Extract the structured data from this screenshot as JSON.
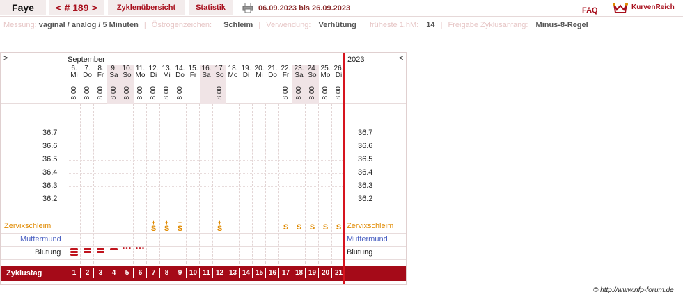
{
  "header": {
    "name": "Faye",
    "cycle_number": "< # 189 >",
    "tab_cycle_overview": "Zyklenübersicht",
    "tab_statistics": "Statistik",
    "date_range": "06.09.2023 bis 26.09.2023",
    "faq": "FAQ",
    "brand": "KurvenReich"
  },
  "meta": {
    "measurement_label": "Messung:",
    "measurement_value": "vaginal / analog / 5 Minuten",
    "estrogen_label": "Östrogenzeichen:",
    "estrogen_value": "Schleim",
    "usage_label": "Verwendung:",
    "usage_value": "Verhütung",
    "earliest_label": "früheste 1.hM:",
    "earliest_value": "14",
    "release_label": "Freigabe Zyklusanfang:",
    "release_value": "Minus-8-Regel"
  },
  "chart": {
    "nav_left": ">",
    "nav_right": "<",
    "month": "September",
    "year": "2023",
    "days": [
      {
        "d": "6.",
        "w": "Mi",
        "t": "8:00",
        "we": false
      },
      {
        "d": "7.",
        "w": "Do",
        "t": "8:00",
        "we": false
      },
      {
        "d": "8.",
        "w": "Fr",
        "t": "8:00",
        "we": false
      },
      {
        "d": "9.",
        "w": "Sa",
        "t": "8:00",
        "we": true
      },
      {
        "d": "10.",
        "w": "So",
        "t": "8:00",
        "we": true
      },
      {
        "d": "11.",
        "w": "Mo",
        "t": "8:00",
        "we": false
      },
      {
        "d": "12.",
        "w": "Di",
        "t": "8:00",
        "we": false
      },
      {
        "d": "13.",
        "w": "Mi",
        "t": "8:00",
        "we": false
      },
      {
        "d": "14.",
        "w": "Do",
        "t": "8:00",
        "we": false
      },
      {
        "d": "15.",
        "w": "Fr",
        "t": "",
        "we": false
      },
      {
        "d": "16.",
        "w": "Sa",
        "t": "",
        "we": true
      },
      {
        "d": "17.",
        "w": "So",
        "t": "8:00",
        "we": true
      },
      {
        "d": "18.",
        "w": "Mo",
        "t": "",
        "we": false
      },
      {
        "d": "19.",
        "w": "Di",
        "t": "",
        "we": false
      },
      {
        "d": "20.",
        "w": "Mi",
        "t": "",
        "we": false
      },
      {
        "d": "21.",
        "w": "Do",
        "t": "",
        "we": false
      },
      {
        "d": "22.",
        "w": "Fr",
        "t": "8:00",
        "we": false
      },
      {
        "d": "23.",
        "w": "Sa",
        "t": "8:00",
        "we": true
      },
      {
        "d": "24.",
        "w": "So",
        "t": "8:00",
        "we": true
      },
      {
        "d": "25.",
        "w": "Mo",
        "t": "8:00",
        "we": false
      },
      {
        "d": "26.",
        "w": "Di",
        "t": "8:00",
        "we": false
      }
    ],
    "temp_labels": [
      "36.7",
      "36.6",
      "36.5",
      "36.4",
      "36.3",
      "36.2"
    ],
    "row_mucus": "Zervixschleim",
    "row_cervix": "Muttermund",
    "row_bleeding": "Blutung",
    "row_cycleday": "Zyklustag",
    "cycle_days": [
      "1",
      "2",
      "3",
      "4",
      "5",
      "6",
      "7",
      "8",
      "9",
      "10",
      "11",
      "12",
      "13",
      "14",
      "15",
      "16",
      "17",
      "18",
      "19",
      "20",
      "21"
    ],
    "mucus_marks": [
      "",
      "",
      "",
      "",
      "",
      "",
      "S+",
      "S+",
      "S+",
      "",
      "",
      "S+",
      "",
      "",
      "",
      "",
      "S",
      "S",
      "S",
      "S",
      "S"
    ],
    "bleeding_marks": [
      "heavy",
      "medium",
      "medium",
      "light",
      "spot",
      "spot",
      "",
      "",
      "",
      "",
      "",
      "",
      "",
      "",
      "",
      "",
      "",
      "",
      "",
      "",
      ""
    ]
  },
  "colors": {
    "accent": "#a8101d",
    "mucus": "#e08a00",
    "cervix": "#4a5fc1",
    "cursor": "#d6141e"
  },
  "footer": {
    "copyright": "© http://www.nfp-forum.de"
  }
}
